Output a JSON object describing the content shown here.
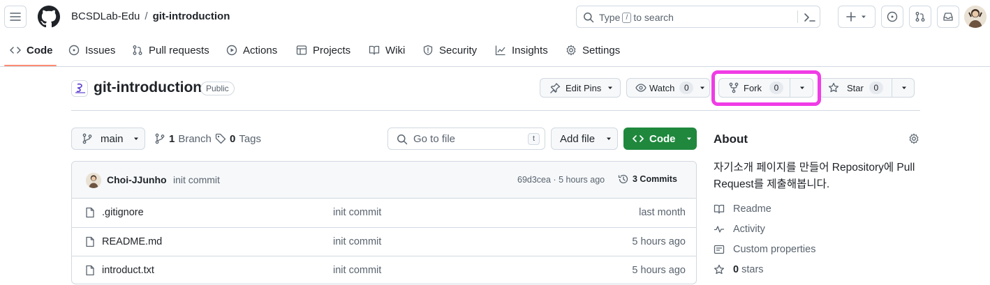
{
  "header": {
    "owner": "BCSDLab-Edu",
    "separator": "/",
    "repo": "git-introduction",
    "search_prefix": "Type",
    "search_key": "/",
    "search_suffix": "to search"
  },
  "nav": {
    "code": "Code",
    "issues": "Issues",
    "pulls": "Pull requests",
    "actions": "Actions",
    "projects": "Projects",
    "wiki": "Wiki",
    "security": "Security",
    "insights": "Insights",
    "settings": "Settings"
  },
  "repo": {
    "title": "git-introduction",
    "visibility": "Public",
    "edit_pins": "Edit Pins",
    "watch": "Watch",
    "watch_count": "0",
    "fork": "Fork",
    "fork_count": "0",
    "star": "Star",
    "star_count": "0",
    "highlight_color": "#f03ce6"
  },
  "toolbar": {
    "branch": "main",
    "branch_count": "1",
    "branch_label": "Branch",
    "tag_count": "0",
    "tag_label": "Tags",
    "goto_placeholder": "Go to file",
    "goto_key": "t",
    "add_file": "Add file",
    "code": "Code",
    "code_color": "#1f883d"
  },
  "commit": {
    "author": "Choi-JJunho",
    "message": "init commit",
    "hash_time": "69d3cea · 5 hours ago",
    "commits": "3 Commits"
  },
  "files": [
    {
      "name": ".gitignore",
      "message": "init commit",
      "date": "last month"
    },
    {
      "name": "README.md",
      "message": "init commit",
      "date": "5 hours ago"
    },
    {
      "name": "introduct.txt",
      "message": "init commit",
      "date": "5 hours ago"
    }
  ],
  "about": {
    "title": "About",
    "description": "자기소개 페이지를 만들어 Repository에 Pull Request를 제출해봅니다.",
    "readme": "Readme",
    "activity": "Activity",
    "custom_properties": "Custom properties",
    "stars_count": "0",
    "stars_label": "stars"
  }
}
